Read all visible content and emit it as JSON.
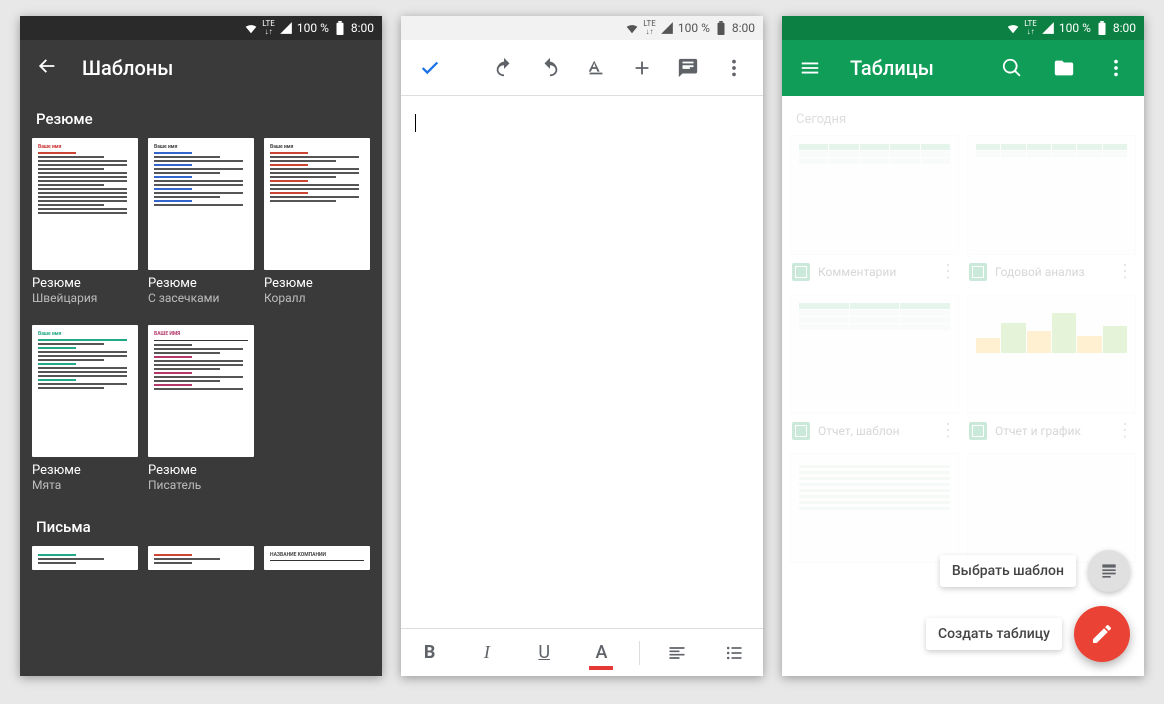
{
  "status": {
    "network": "LTE",
    "battery": "100 %",
    "time": "8:00"
  },
  "screen1": {
    "title": "Шаблоны",
    "section_resume": "Резюме",
    "section_letters": "Письма",
    "templates_row1": [
      {
        "title": "Резюме",
        "sub": "Швейцария",
        "thumb_title": "Ваше имя"
      },
      {
        "title": "Резюме",
        "sub": "С засечками",
        "thumb_title": "Ваше имя"
      },
      {
        "title": "Резюме",
        "sub": "Коралл",
        "thumb_title": "Ваше имя"
      }
    ],
    "templates_row2": [
      {
        "title": "Резюме",
        "sub": "Мята",
        "thumb_title": "Ваше имя"
      },
      {
        "title": "Резюме",
        "sub": "Писатель",
        "thumb_title": "ВАШЕ ИМЯ"
      }
    ],
    "letters_row": [
      {
        "thumb_title": ""
      },
      {
        "thumb_title": ""
      },
      {
        "thumb_title": "НАЗВАНИЕ КОМПАНИИ"
      }
    ]
  },
  "screen2": {
    "toolbar_icons": {
      "accept": "accept-icon",
      "undo": "undo-icon",
      "redo": "redo-icon",
      "format": "text-format-icon",
      "add": "plus-icon",
      "comment": "comment-icon",
      "overflow": "more-vert-icon"
    },
    "bottom": {
      "bold": "B",
      "italic": "I",
      "underline": "U",
      "color": "A"
    }
  },
  "screen3": {
    "title": "Таблицы",
    "section_today": "Сегодня",
    "files": [
      {
        "name": "Комментарии"
      },
      {
        "name": "Годовой анализ"
      },
      {
        "name": "Отчет, шаблон"
      },
      {
        "name": "Отчет и график"
      }
    ],
    "fab": {
      "choose_template": "Выбрать шаблон",
      "create_table": "Создать таблицу"
    }
  }
}
